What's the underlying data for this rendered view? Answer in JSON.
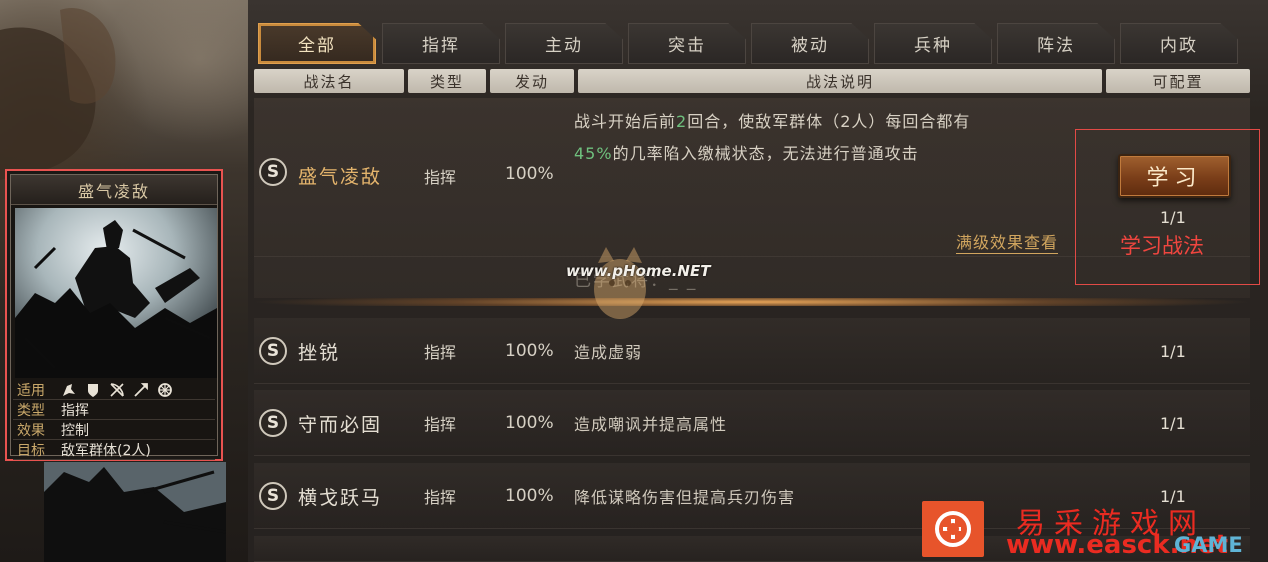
{
  "tabs": [
    {
      "label": "全部",
      "active": true
    },
    {
      "label": "指挥",
      "active": false
    },
    {
      "label": "主动",
      "active": false
    },
    {
      "label": "突击",
      "active": false
    },
    {
      "label": "被动",
      "active": false
    },
    {
      "label": "兵种",
      "active": false
    },
    {
      "label": "阵法",
      "active": false
    },
    {
      "label": "内政",
      "active": false
    }
  ],
  "columns": {
    "name": "战法名",
    "type": "类型",
    "rate": "发动",
    "desc": "战法说明",
    "config": "可配置"
  },
  "card": {
    "title": "盛气凌敌",
    "stats": [
      {
        "key": "适用",
        "value": ""
      },
      {
        "key": "类型",
        "value": "指挥"
      },
      {
        "key": "效果",
        "value": "控制"
      },
      {
        "key": "目标",
        "value": "敌军群体(2人)"
      }
    ],
    "troop_icons": [
      "cavalry-icon",
      "shield-icon",
      "bow-icon",
      "spear-icon",
      "wheel-icon"
    ]
  },
  "expanded_skill": {
    "grade": "S",
    "name": "盛气凌敌",
    "type": "指挥",
    "rate": "100%",
    "desc_line1_a": "战斗开始后前",
    "desc_line1_hl": "2",
    "desc_line1_b": "回合，使敌军群体（2人）每回合都有",
    "desc_line2_hl": "45%",
    "desc_line2_b": "的几率陷入缴械状态，无法进行普通攻击",
    "detail_link": "满级效果查看",
    "learn_button": "学习",
    "count": "1/1",
    "hidden_text": "已学武将：_ _"
  },
  "skills": [
    {
      "grade": "S",
      "name": "挫锐",
      "type": "指挥",
      "rate": "100%",
      "desc": "造成虚弱",
      "count": "1/1"
    },
    {
      "grade": "S",
      "name": "守而必固",
      "type": "指挥",
      "rate": "100%",
      "desc": "造成嘲讽并提高属性",
      "count": "1/1"
    },
    {
      "grade": "S",
      "name": "横戈跃马",
      "type": "指挥",
      "rate": "100%",
      "desc": "降低谋略伤害但提高兵刃伤害",
      "count": "1/1"
    }
  ],
  "annotation": {
    "text": "学习战法",
    "color": "#f0463f"
  },
  "watermarks": {
    "pchome": "www.pHome.NET",
    "site_cn": "易采游戏网",
    "site_url": "www.easck.net",
    "site_game": "GAME"
  },
  "colors": {
    "highlight_green": "#6fc07e",
    "skill_gold": "#e4b46c",
    "annotation_red": "#e24a46",
    "learn_button": "#7a3e19"
  }
}
